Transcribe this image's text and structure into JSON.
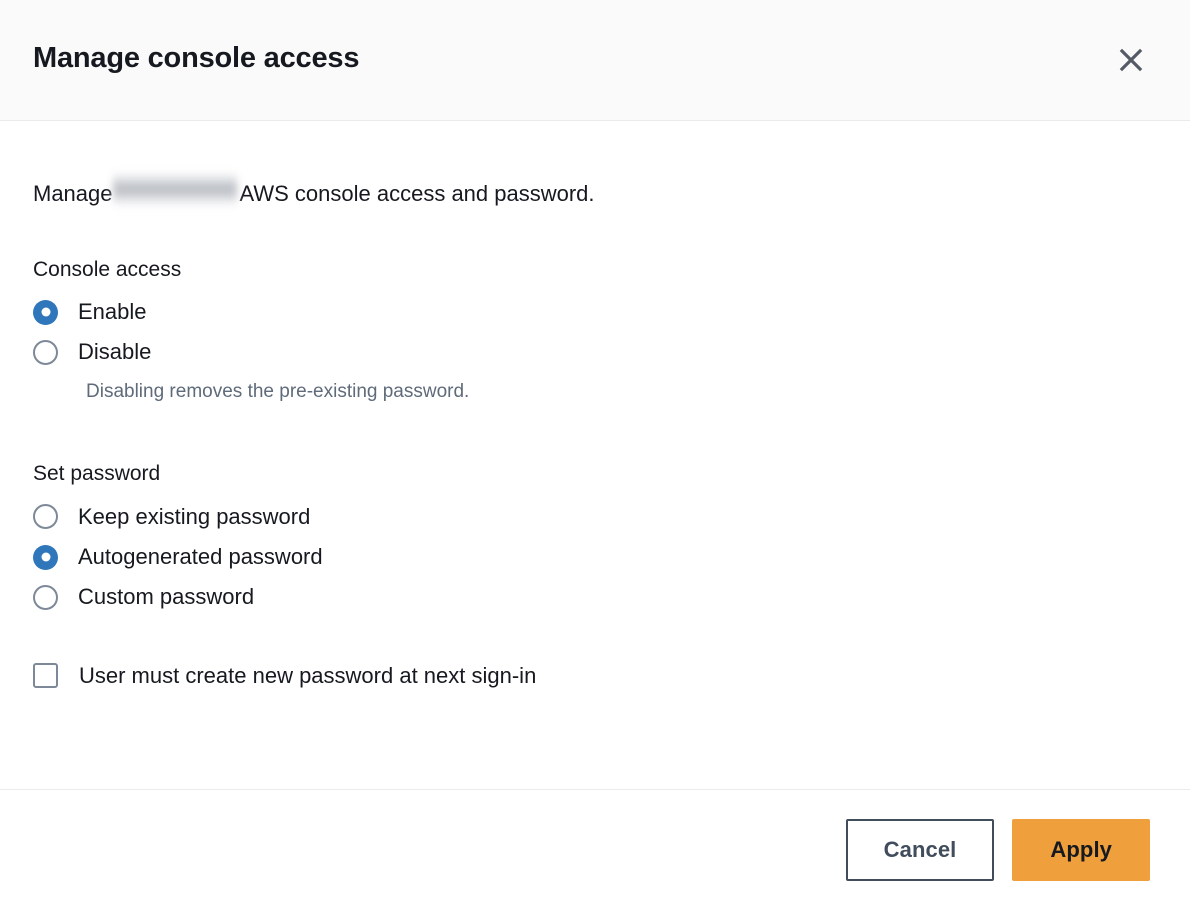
{
  "modal": {
    "title": "Manage console access",
    "close_icon": "close-x-icon",
    "intro": {
      "prefix": "Manage",
      "redacted": "",
      "suffix": "AWS console access and password."
    },
    "console_access": {
      "label": "Console access",
      "options": [
        {
          "label": "Enable",
          "selected": true
        },
        {
          "label": "Disable",
          "selected": false
        }
      ],
      "helper_text": "Disabling removes the pre-existing password."
    },
    "set_password": {
      "label": "Set password",
      "options": [
        {
          "label": "Keep existing password",
          "selected": false
        },
        {
          "label": "Autogenerated password",
          "selected": true
        },
        {
          "label": "Custom password",
          "selected": false
        }
      ]
    },
    "force_reset": {
      "label": "User must create new password at next sign-in",
      "checked": false
    },
    "footer": {
      "cancel_label": "Cancel",
      "apply_label": "Apply"
    },
    "colors": {
      "accent_blue": "#2f77ba",
      "primary_orange": "#ef9f3c",
      "text_dark": "#16191f",
      "text_muted": "#5f6b7a",
      "control_border": "#7d8998",
      "button_border": "#414d5c",
      "header_bg": "#fafafa",
      "divider": "#e9ebed"
    }
  }
}
